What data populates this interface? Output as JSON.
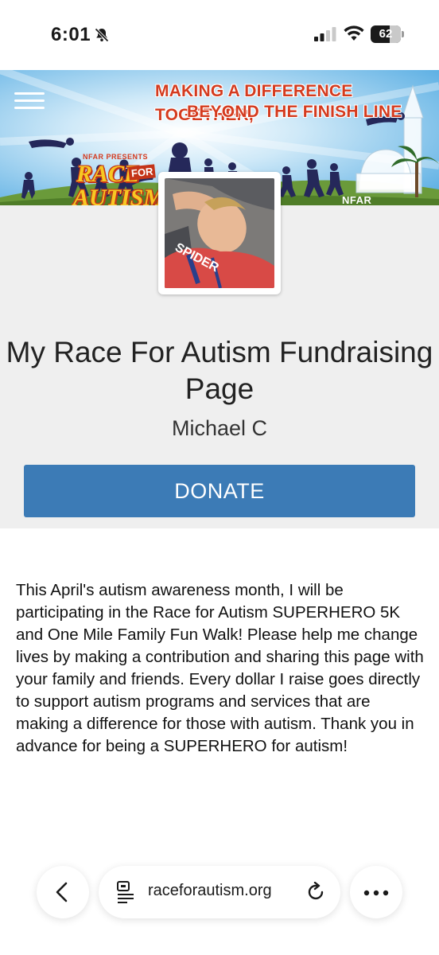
{
  "status_bar": {
    "time": "6:01",
    "battery_level": "62",
    "battery_fraction": 0.62
  },
  "banner": {
    "headline_line1": "MAKING A DIFFERENCE TOGETHER,",
    "headline_line2": "BEYOND THE FINISH LINE",
    "logo_presents": "NFAR PRESENTS",
    "logo_race": "RACE",
    "logo_for": "FOR",
    "logo_autism": "AUTISM",
    "logo_tag": "NFAR"
  },
  "profile": {
    "avatar_alt": "Fundraiser profile photo",
    "page_title": "My Race For Autism Fundraising Page",
    "fundraiser_name": "Michael C"
  },
  "donate": {
    "label": "DONATE"
  },
  "story": {
    "text": "This April's autism awareness month, I will be participating in the  Race for Autism SUPERHERO 5K and One Mile Family Fun Walk! Please help me change lives by making a contribution and sharing this page with your family and friends. Every dollar I raise goes directly to support autism programs and services that are making a difference for those with autism. Thank you in advance for being a SUPERHERO for autism!"
  },
  "browser": {
    "url": "raceforautism.org"
  },
  "colors": {
    "donate_button": "#3c7bb6",
    "profile_background": "#efefef",
    "banner_sky": "#6fb8e8",
    "headline_red": "#d43b1f"
  }
}
